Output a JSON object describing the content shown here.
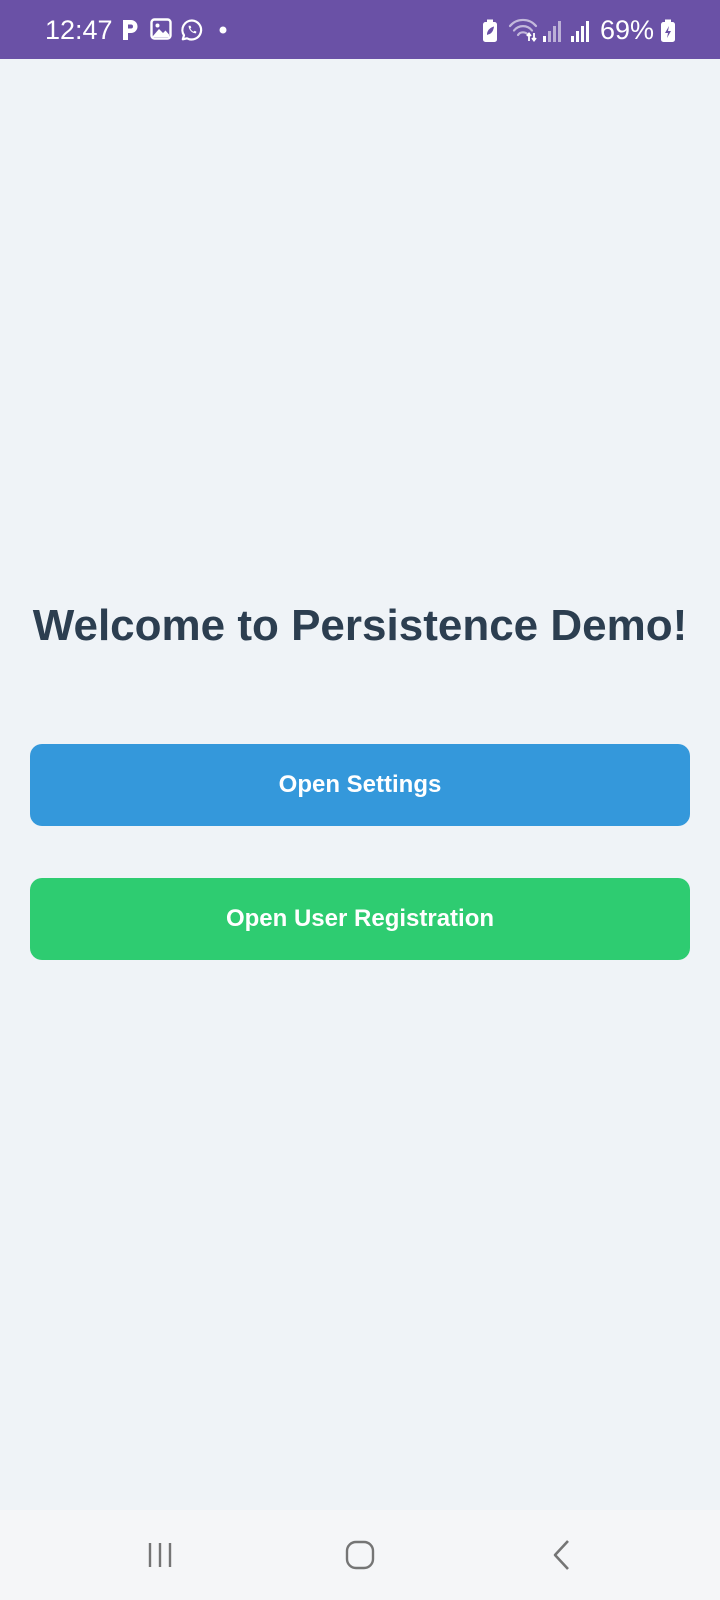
{
  "status_bar": {
    "time": "12:47",
    "battery_percent": "69%",
    "background_color": "#6a51a6",
    "left_icons": [
      "p-notification-icon",
      "gallery-icon",
      "whatsapp-icon",
      "dot-icon"
    ],
    "right_icons": [
      "battery-saver-icon",
      "wifi-icon",
      "signal-icon",
      "signal-icon",
      "battery-icon"
    ]
  },
  "main": {
    "title": "Welcome to Persistence Demo!",
    "buttons": {
      "settings_label": "Open Settings",
      "registration_label": "Open User Registration"
    }
  },
  "colors": {
    "background": "#eff3f7",
    "title": "#2c3e50",
    "settings_button": "#3498db",
    "registration_button": "#2ecc71"
  },
  "nav_bar": {
    "buttons": [
      "recent-apps-icon",
      "home-icon",
      "back-icon"
    ]
  }
}
